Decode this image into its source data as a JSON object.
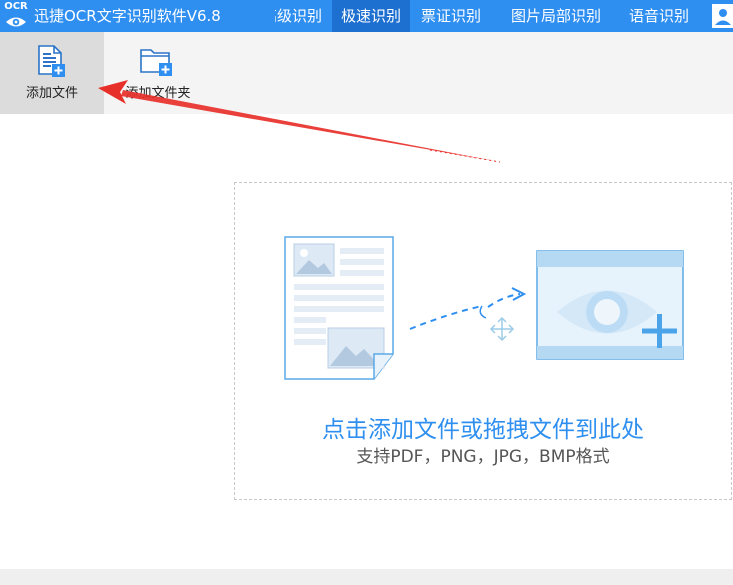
{
  "app": {
    "logo_text": "OCR",
    "title": "迅捷OCR文字识别软件V6.8"
  },
  "tabs": [
    {
      "label": "高级识别"
    },
    {
      "label": "极速识别"
    },
    {
      "label": "票证识别"
    },
    {
      "label": "图片局部识别"
    },
    {
      "label": "语音识别"
    }
  ],
  "toolbar": {
    "add_file_label": "添加文件",
    "add_folder_label": "添加文件夹"
  },
  "dropzone": {
    "main_text": "点击添加文件或拖拽文件到此处",
    "sub_text": "支持PDF，PNG，JPG，BMP格式"
  },
  "colors": {
    "accent": "#2f8ff0",
    "active_tab": "#1d6fd0",
    "annotation_arrow": "#e8302a"
  },
  "icons": {
    "add_file": "file-plus-icon",
    "add_folder": "folder-plus-icon",
    "user": "user-icon"
  }
}
